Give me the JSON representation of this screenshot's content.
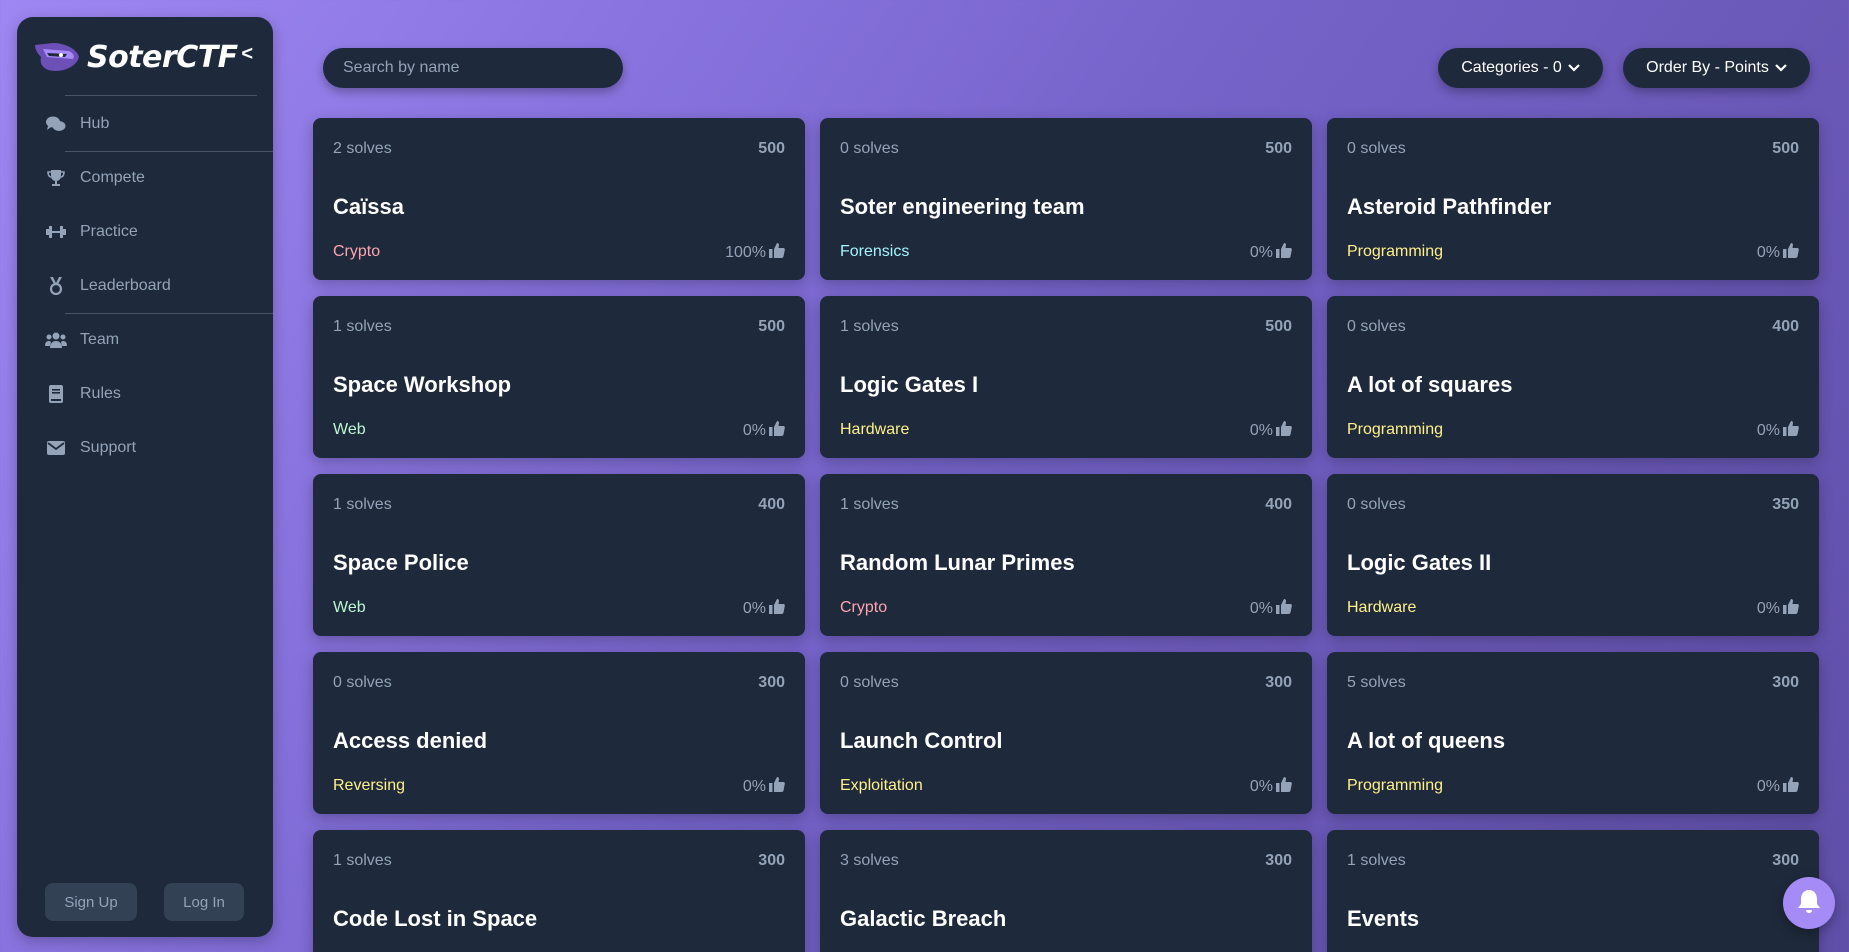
{
  "brand": {
    "name": "SoterCTF",
    "collapse": "<"
  },
  "nav": [
    {
      "label": "Hub",
      "icon": "comments-icon"
    },
    {
      "label": "Compete",
      "icon": "trophy-icon"
    },
    {
      "label": "Practice",
      "icon": "dumbbell-icon"
    },
    {
      "label": "Leaderboard",
      "icon": "medal-icon"
    },
    {
      "label": "Team",
      "icon": "users-icon"
    },
    {
      "label": "Rules",
      "icon": "book-icon"
    },
    {
      "label": "Support",
      "icon": "envelope-icon"
    }
  ],
  "auth": {
    "signup": "Sign Up",
    "login": "Log In"
  },
  "search": {
    "placeholder": "Search by name"
  },
  "filters": {
    "categories": "Categories - 0",
    "order": "Order By - Points"
  },
  "colors": {
    "crypto": "#fda4af",
    "forensics": "#a5f3fc",
    "programming": "#fef08a",
    "web": "#bbf7d0",
    "hardware": "#fef08a",
    "reversing": "#fef08a",
    "exploitation": "#fef08a"
  },
  "challenges": [
    {
      "solves": "2 solves",
      "points": "500",
      "title": "Caïssa",
      "category": "Crypto",
      "rating": "100%"
    },
    {
      "solves": "0 solves",
      "points": "500",
      "title": "Soter engineering team",
      "category": "Forensics",
      "rating": "0%"
    },
    {
      "solves": "0 solves",
      "points": "500",
      "title": "Asteroid Pathfinder",
      "category": "Programming",
      "rating": "0%"
    },
    {
      "solves": "1 solves",
      "points": "500",
      "title": "Space Workshop",
      "category": "Web",
      "rating": "0%"
    },
    {
      "solves": "1 solves",
      "points": "500",
      "title": "Logic Gates I",
      "category": "Hardware",
      "rating": "0%"
    },
    {
      "solves": "0 solves",
      "points": "400",
      "title": "A lot of squares",
      "category": "Programming",
      "rating": "0%"
    },
    {
      "solves": "1 solves",
      "points": "400",
      "title": "Space Police",
      "category": "Web",
      "rating": "0%"
    },
    {
      "solves": "1 solves",
      "points": "400",
      "title": "Random Lunar Primes",
      "category": "Crypto",
      "rating": "0%"
    },
    {
      "solves": "0 solves",
      "points": "350",
      "title": "Logic Gates II",
      "category": "Hardware",
      "rating": "0%"
    },
    {
      "solves": "0 solves",
      "points": "300",
      "title": "Access denied",
      "category": "Reversing",
      "rating": "0%"
    },
    {
      "solves": "0 solves",
      "points": "300",
      "title": "Launch Control",
      "category": "Exploitation",
      "rating": "0%"
    },
    {
      "solves": "5 solves",
      "points": "300",
      "title": "A lot of queens",
      "category": "Programming",
      "rating": "0%"
    },
    {
      "solves": "1 solves",
      "points": "300",
      "title": "Code Lost in Space",
      "category": "",
      "rating": ""
    },
    {
      "solves": "3 solves",
      "points": "300",
      "title": "Galactic Breach",
      "category": "",
      "rating": ""
    },
    {
      "solves": "1 solves",
      "points": "300",
      "title": "Events",
      "category": "",
      "rating": ""
    }
  ]
}
